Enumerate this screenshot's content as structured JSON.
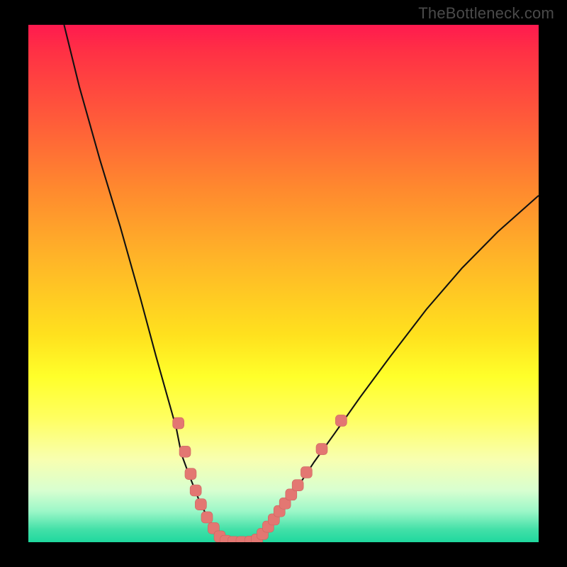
{
  "attribution": "TheBottleneck.com",
  "colors": {
    "background": "#000000",
    "gradient_top": "#ff1a4f",
    "gradient_bottom": "#1fd89e",
    "curve": "#111111",
    "marker": "#e37772"
  },
  "chart_data": {
    "type": "line",
    "title": "",
    "xlabel": "",
    "ylabel": "",
    "xlim": [
      0,
      100
    ],
    "ylim": [
      0,
      100
    ],
    "grid": false,
    "axes_visible": false,
    "series": [
      {
        "name": "left-branch",
        "x": [
          7,
          10,
          14,
          18,
          22,
          25,
          27,
          29,
          30,
          31.5,
          32.5,
          33.5,
          35,
          36.5,
          37.5,
          38.5
        ],
        "y": [
          100,
          88,
          74,
          61,
          47,
          36,
          29,
          22,
          17,
          13,
          10.5,
          8,
          5,
          2.5,
          1.2,
          0.2
        ]
      },
      {
        "name": "bottom-flat",
        "x": [
          38.5,
          40,
          42,
          44,
          44.8
        ],
        "y": [
          0.2,
          0,
          0,
          0,
          0.2
        ]
      },
      {
        "name": "right-branch",
        "x": [
          44.8,
          46,
          47.5,
          49,
          51,
          53,
          56,
          60,
          65,
          71,
          78,
          85,
          92,
          100
        ],
        "y": [
          0.2,
          1.5,
          3.5,
          5.3,
          8,
          11,
          15.5,
          21,
          28,
          36,
          45,
          53,
          60,
          67
        ]
      }
    ],
    "markers_note": "Rounded-square pink markers plotted along both branches near the valley",
    "markers": [
      {
        "branch": "left",
        "x": 29.4,
        "y": 23
      },
      {
        "branch": "left",
        "x": 30.7,
        "y": 17.5
      },
      {
        "branch": "left",
        "x": 31.8,
        "y": 13.2
      },
      {
        "branch": "left",
        "x": 32.8,
        "y": 10
      },
      {
        "branch": "left",
        "x": 33.8,
        "y": 7.3
      },
      {
        "branch": "left",
        "x": 35.0,
        "y": 4.8
      },
      {
        "branch": "left",
        "x": 36.3,
        "y": 2.7
      },
      {
        "branch": "left",
        "x": 37.5,
        "y": 1.1
      },
      {
        "branch": "flat",
        "x": 38.7,
        "y": 0.25
      },
      {
        "branch": "flat",
        "x": 40.2,
        "y": 0.05
      },
      {
        "branch": "flat",
        "x": 41.8,
        "y": 0.05
      },
      {
        "branch": "flat",
        "x": 43.5,
        "y": 0.1
      },
      {
        "branch": "right",
        "x": 44.8,
        "y": 0.5
      },
      {
        "branch": "right",
        "x": 45.9,
        "y": 1.6
      },
      {
        "branch": "right",
        "x": 47.0,
        "y": 3.0
      },
      {
        "branch": "right",
        "x": 48.1,
        "y": 4.4
      },
      {
        "branch": "right",
        "x": 49.2,
        "y": 6.0
      },
      {
        "branch": "right",
        "x": 50.3,
        "y": 7.5
      },
      {
        "branch": "right",
        "x": 51.5,
        "y": 9.2
      },
      {
        "branch": "right",
        "x": 52.8,
        "y": 11
      },
      {
        "branch": "right",
        "x": 54.5,
        "y": 13.5
      },
      {
        "branch": "right",
        "x": 57.5,
        "y": 18
      },
      {
        "branch": "right",
        "x": 61.3,
        "y": 23.5
      }
    ]
  }
}
